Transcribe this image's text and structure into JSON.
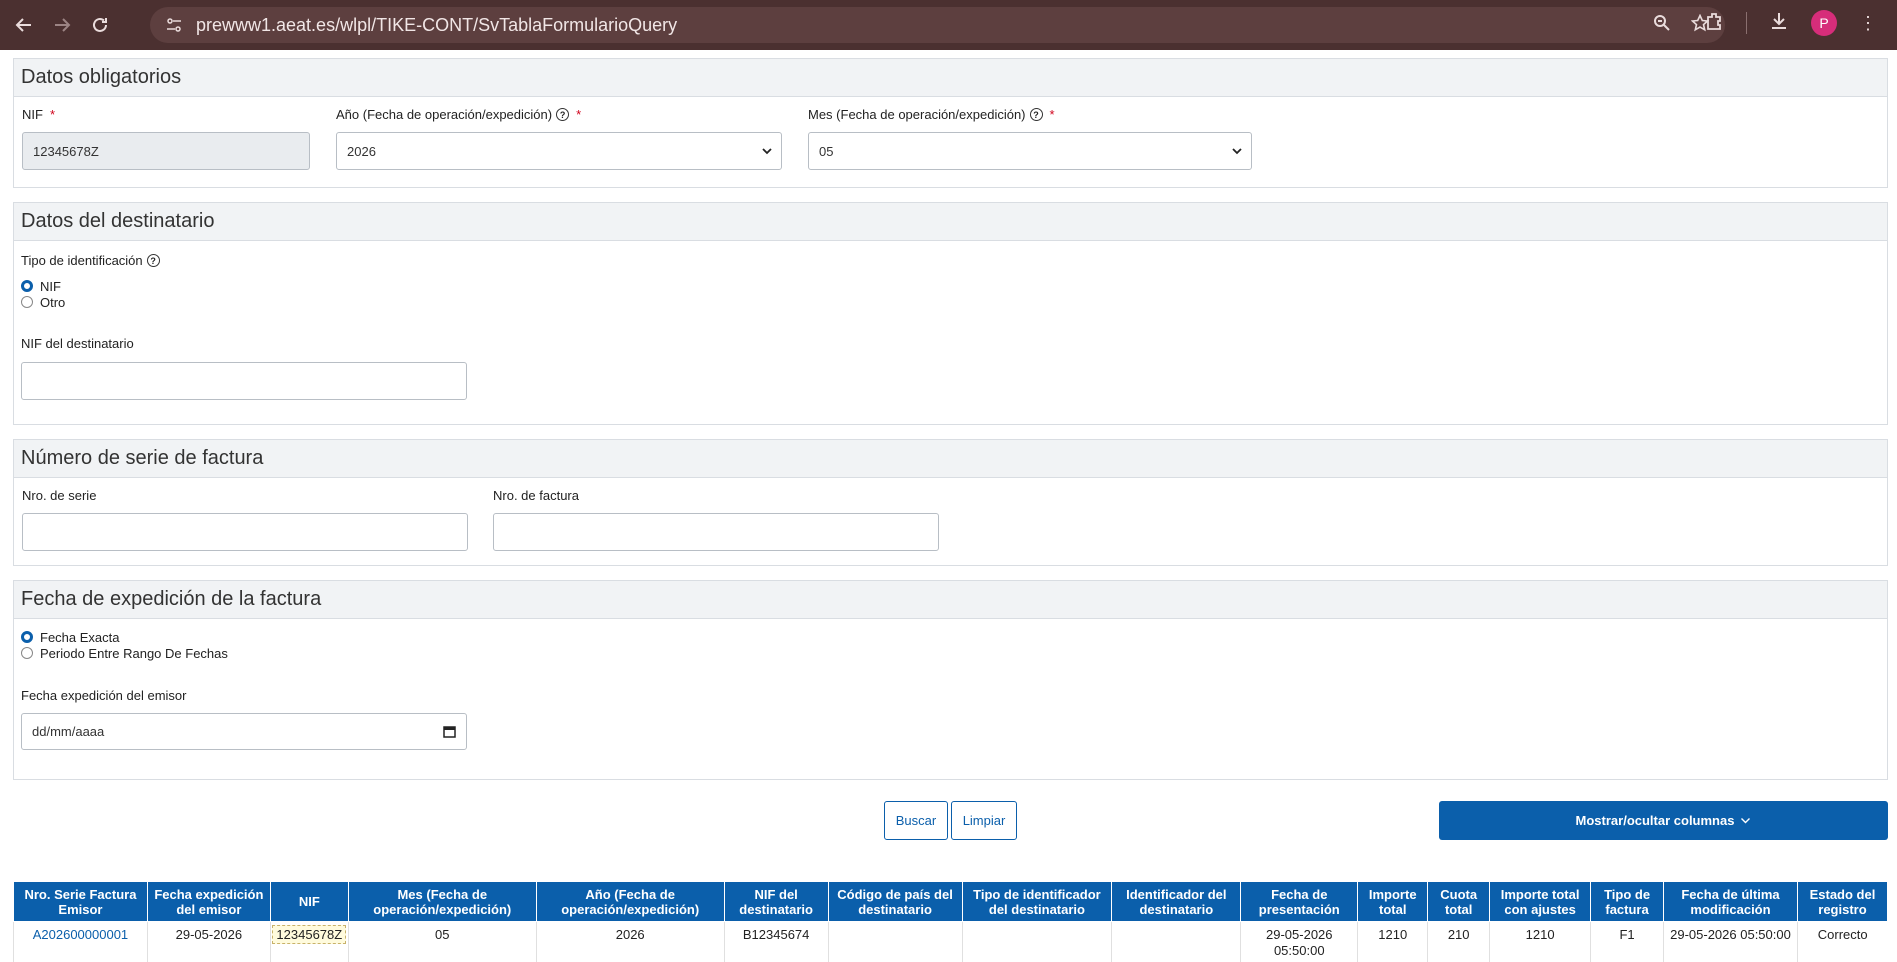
{
  "browser": {
    "url": "prewww1.aeat.es/wlpl/TIKE-CONT/SvTablaFormularioQuery",
    "avatar_letter": "P"
  },
  "sections": {
    "obligatorios": {
      "title": "Datos obligatorios",
      "nif_label": "NIF",
      "nif_value": "12345678Z",
      "anio_label": "Año (Fecha de operación/expedición)",
      "anio_value": "2026",
      "mes_label": "Mes (Fecha de operación/expedición)",
      "mes_value": "05"
    },
    "destinatario": {
      "title": "Datos del destinatario",
      "tipo_label": "Tipo de identificación",
      "opt_nif": "NIF",
      "opt_otro": "Otro",
      "nif_dest_label": "NIF del destinatario",
      "nif_dest_value": ""
    },
    "serie": {
      "title": "Número de serie de factura",
      "serie_label": "Nro. de serie",
      "serie_value": "",
      "factura_label": "Nro. de factura",
      "factura_value": ""
    },
    "fecha": {
      "title": "Fecha de expedición de la factura",
      "opt_exacta": "Fecha Exacta",
      "opt_rango": "Periodo Entre Rango De Fechas",
      "fecha_label": "Fecha expedición del emisor",
      "fecha_placeholder": "dd/mm/aaaa"
    }
  },
  "buttons": {
    "buscar": "Buscar",
    "limpiar": "Limpiar",
    "columnas": "Mostrar/ocultar columnas"
  },
  "table": {
    "headers": [
      "Nro. Serie Factura Emisor",
      "Fecha expedición del emisor",
      "NIF",
      "Mes (Fecha de operación/expedición)",
      "Año (Fecha de operación/expedición)",
      "NIF del destinatario",
      "Código de país del destinatario",
      "Tipo de identificador del destinatario",
      "Identificador del destinatario",
      "Fecha de presentación",
      "Importe total",
      "Cuota total",
      "Importe total con ajustes",
      "Tipo de factura",
      "Fecha de última modificación",
      "Estado del registro"
    ],
    "rows": [
      {
        "serie": "A202600000001",
        "fecha_exp": "29-05-2026",
        "nif": "12345678Z",
        "mes": "05",
        "anio": "2026",
        "nif_dest": "B12345674",
        "pais": "",
        "tipo_id": "",
        "identificador": "",
        "fecha_pres_1": "29-05-2026",
        "fecha_pres_2": "05:50:00",
        "importe": "1210",
        "cuota": "210",
        "importe_ajustes": "1210",
        "tipo_factura": "F1",
        "fecha_mod": "29-05-2026 05:50:00",
        "estado": "Correcto"
      }
    ]
  }
}
